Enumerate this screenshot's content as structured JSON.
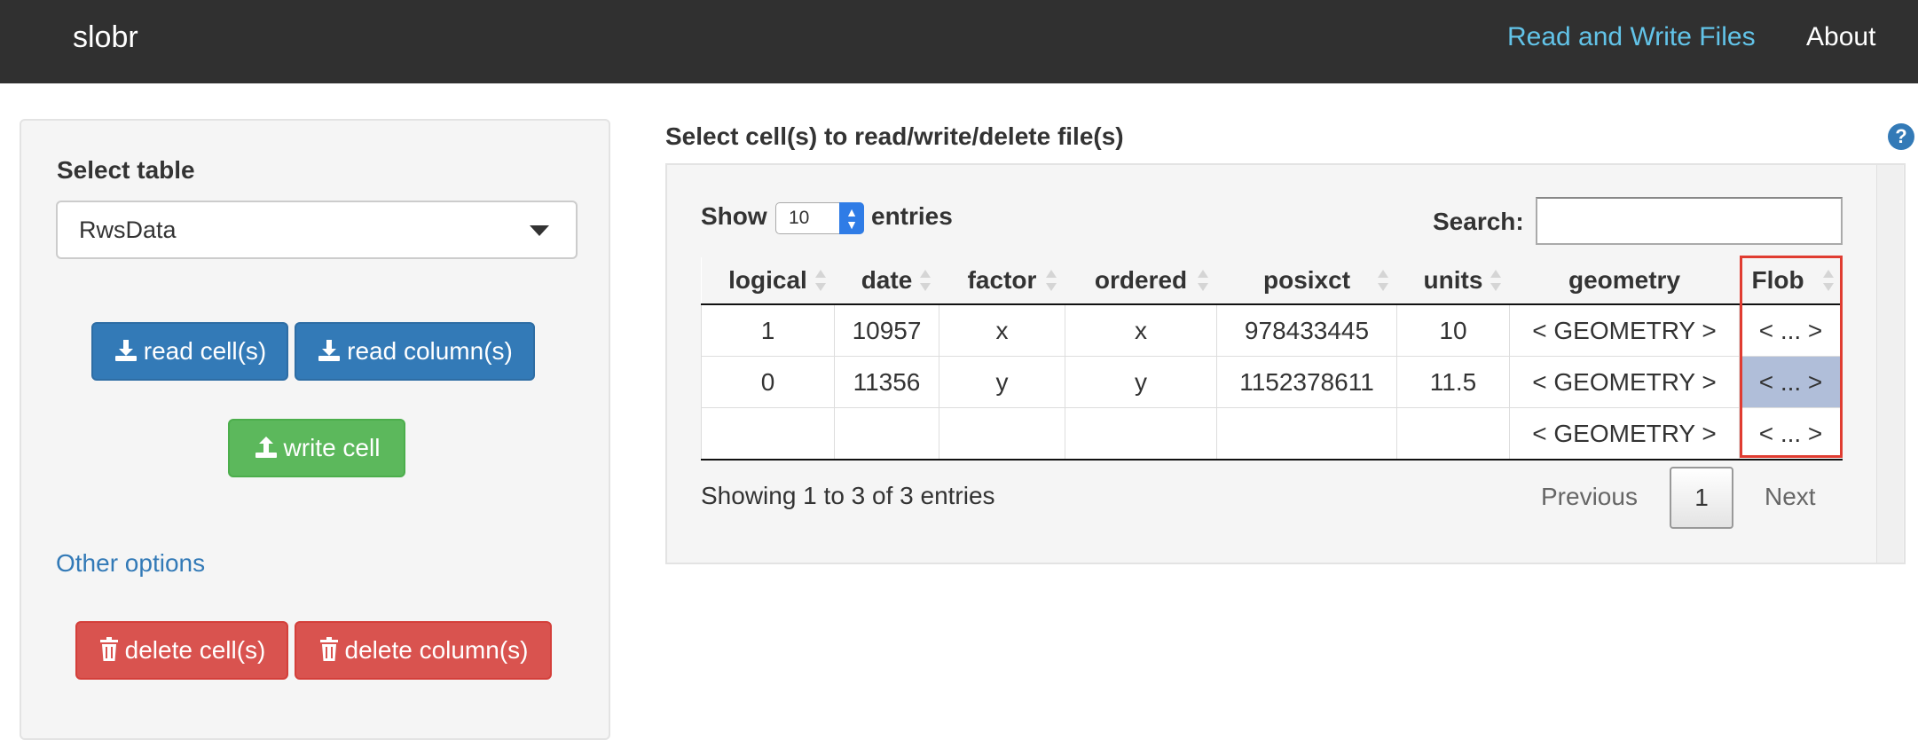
{
  "navbar": {
    "brand": "slobr",
    "links": [
      "Read and Write Files",
      "About"
    ]
  },
  "sidebar": {
    "select_label": "Select table",
    "select_value": "RwsData",
    "read_cells_label": "read cell(s)",
    "read_columns_label": "read column(s)",
    "write_cell_label": "write cell",
    "other_options_label": "Other options",
    "delete_cells_label": "delete cell(s)",
    "delete_columns_label": "delete column(s)"
  },
  "main": {
    "title": "Select cell(s) to read/write/delete file(s)",
    "help": "?",
    "show_label": "Show",
    "page_length": "10",
    "entries_label": "entries",
    "search_label": "Search:",
    "search_value": "",
    "columns": [
      "logical",
      "date",
      "factor",
      "ordered",
      "posixct",
      "units",
      "geometry",
      "Flob"
    ],
    "rows": [
      [
        "1",
        "10957",
        "x",
        "x",
        "978433445",
        "10",
        "< GEOMETRY >",
        "< ... >"
      ],
      [
        "0",
        "11356",
        "y",
        "y",
        "1152378611",
        "11.5",
        "< GEOMETRY >",
        "< ... >"
      ],
      [
        "",
        "",
        "",
        "",
        "",
        "",
        "< GEOMETRY >",
        "< ... >"
      ]
    ],
    "selected_cell": {
      "row": 1,
      "column": "Flob"
    },
    "info": "Showing 1 to 3 of 3 entries",
    "pagination": {
      "previous": "Previous",
      "current": "1",
      "next": "Next"
    }
  },
  "colors": {
    "navbar_bg": "#303030",
    "active_link": "#62c3e8",
    "primary": "#337ab7",
    "success": "#5cb85c",
    "danger": "#d9534f",
    "selected_cell": "#b0bed9",
    "highlight_outline": "#e03c31"
  }
}
